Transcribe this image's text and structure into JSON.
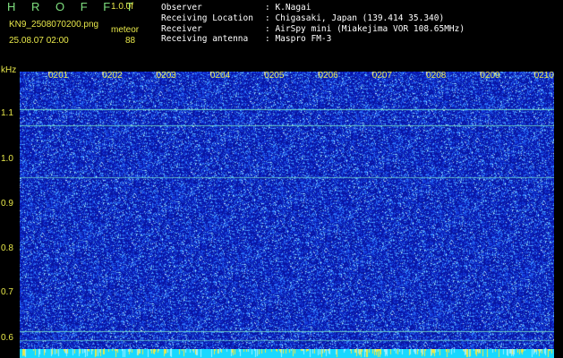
{
  "header": {
    "app_title": "H R O F F T",
    "version": "1.0.0f",
    "filename": "KN9_2508070200.png",
    "mode": "meteor",
    "datetime": "25.08.07 02:00",
    "count": "88"
  },
  "info": {
    "observer_label": "Observer",
    "observer_value": "K.Nagai",
    "location_label": "Receiving Location",
    "location_value": "Chigasaki, Japan (139.414 35.340)",
    "receiver_label": "Receiver",
    "receiver_value": "AirSpy mini (Miakejima VOR 108.65MHz)",
    "antenna_label": "Receiving antenna",
    "antenna_value": "Maspro FM-3"
  },
  "axis": {
    "unit": "kHz",
    "y_ticks": [
      "1.1",
      "1.0",
      "0.9",
      "0.8",
      "0.7",
      "0.6"
    ],
    "x_ticks": [
      "0201",
      "0202",
      "0203",
      "0204",
      "0205",
      "0206",
      "0207",
      "0208",
      "0209",
      "0210"
    ]
  },
  "colors": {
    "background": "#0c1aa0",
    "noise": "#3a8cff",
    "line": "#55e0c8",
    "label": "#e8e84a"
  }
}
